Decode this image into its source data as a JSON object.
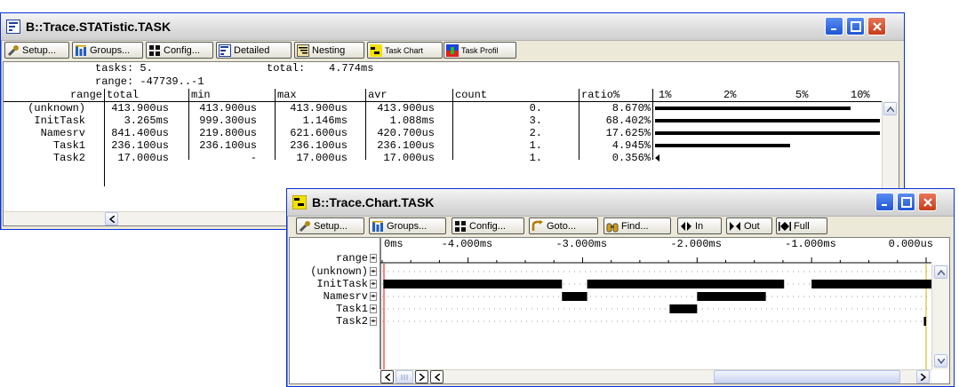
{
  "stat_window": {
    "title": "B::Trace.STATistic.TASK",
    "toolbar": {
      "setup": "Setup...",
      "groups": "Groups...",
      "config": "Config...",
      "detailed": "Detailed",
      "nesting": "Nesting",
      "task_chart": "Task Chart",
      "task_profile": "Task Profil"
    },
    "summary": {
      "tasks": "tasks: 5.",
      "total_label": "total:",
      "total_value": "4.774ms",
      "range": "range: -47739..-1"
    },
    "columns": [
      "range",
      "total",
      "min",
      "max",
      "avr",
      "count",
      "ratio%"
    ],
    "scale_labels": [
      "1%",
      "2%",
      "5%",
      "10%"
    ],
    "rows": [
      {
        "range": "(unknown)",
        "total": "413.900us",
        "min": "413.900us",
        "max": "413.900us",
        "avr": "413.900us",
        "count": "0.",
        "ratio": "8.670%",
        "bar": 0.87
      },
      {
        "range": "InitTask",
        "total": "3.265ms",
        "min": "999.300us",
        "max": "1.146ms",
        "avr": "1.088ms",
        "count": "3.",
        "ratio": "68.402%",
        "bar": 1.0
      },
      {
        "range": "Namesrv",
        "total": "841.400us",
        "min": "219.800us",
        "max": "621.600us",
        "avr": "420.700us",
        "count": "2.",
        "ratio": "17.625%",
        "bar": 1.0
      },
      {
        "range": "Task1",
        "total": "236.100us",
        "min": "236.100us",
        "max": "236.100us",
        "avr": "236.100us",
        "count": "1.",
        "ratio": "4.945%",
        "bar": 0.6
      },
      {
        "range": "Task2",
        "total": "17.000us",
        "min": "-",
        "max": "17.000us",
        "avr": "17.000us",
        "count": "1.",
        "ratio": "0.356%",
        "bar": 0.0
      }
    ]
  },
  "chart_window": {
    "title": "B::Trace.Chart.TASK",
    "toolbar": {
      "setup": "Setup...",
      "groups": "Groups...",
      "config": "Config...",
      "goto": "Goto...",
      "find": "Find...",
      "in": "In",
      "out": "Out",
      "full": "Full"
    },
    "time_labels": [
      "0ms",
      "-4.000ms",
      "-3.000ms",
      "-2.000ms",
      "-1.000ms",
      "0.000us"
    ],
    "range_label": "range",
    "tasks": [
      "(unknown)",
      "InitTask",
      "Namesrv",
      "Task1",
      "Task2"
    ],
    "time_axis_ms": [
      -4.75,
      0
    ],
    "segments": [
      {
        "task": "InitTask",
        "start_ms": -4.74,
        "end_ms": -3.18
      },
      {
        "task": "InitTask",
        "start_ms": -2.96,
        "end_ms": -1.24
      },
      {
        "task": "InitTask",
        "start_ms": -1.0,
        "end_ms": 0.12
      },
      {
        "task": "Namesrv",
        "start_ms": -3.18,
        "end_ms": -2.96
      },
      {
        "task": "Namesrv",
        "start_ms": -2.0,
        "end_ms": -1.4
      },
      {
        "task": "Task1",
        "start_ms": -2.24,
        "end_ms": -2.0
      },
      {
        "task": "Task2",
        "start_ms": -0.02,
        "end_ms": 0.0
      }
    ]
  },
  "colors": {
    "xp_blue": "#0831d9",
    "close_red": "#c73b1a",
    "cursor_red": "#ff0000",
    "cursor_yellow": "#c8b400",
    "bar": "#000000"
  }
}
